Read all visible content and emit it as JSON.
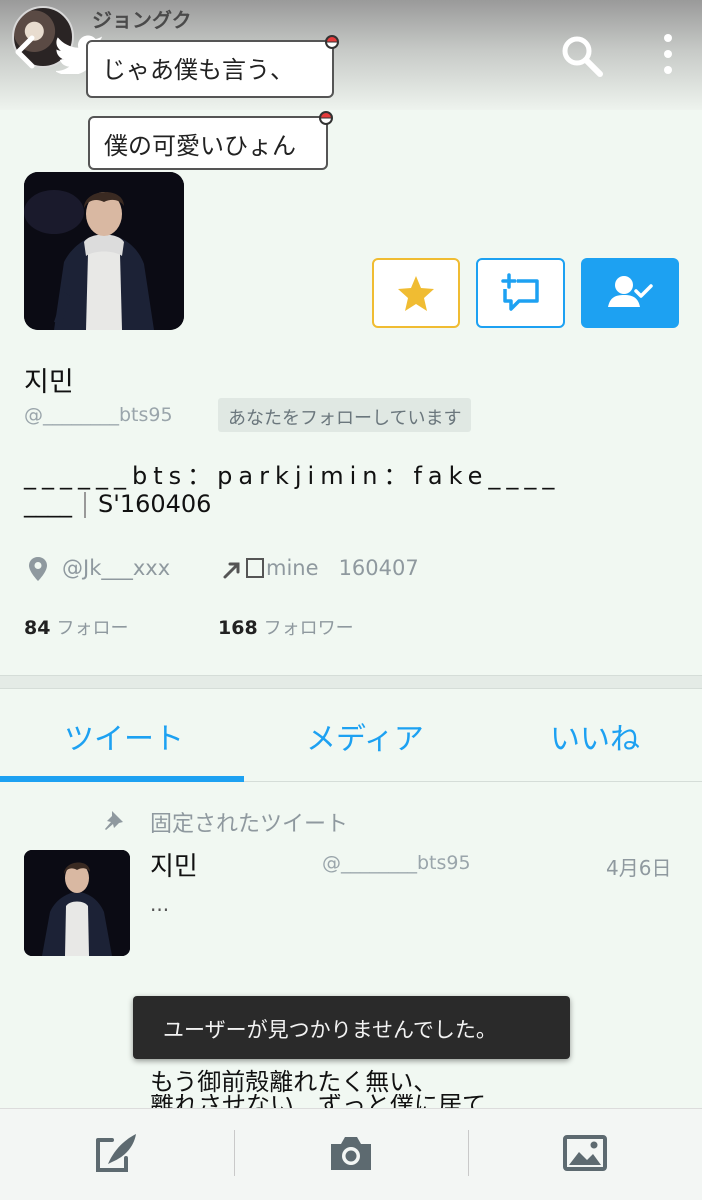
{
  "header": {
    "account_name": "ジョングク",
    "bubble1": "じゃあ僕も言う、",
    "bubble2": "僕の可愛いひょん"
  },
  "profile": {
    "display_name": "지민",
    "handle": "@________bts95",
    "follows_you": "あなたをフォローしています",
    "bio_line1": "______bts：parkjimin：fake____",
    "bio_line2_prefix": "____",
    "bio_line2_suffix": "S'160406",
    "location": "@Jk___xxx",
    "link": "mine",
    "joined": "160407",
    "following_count": "84",
    "following_label": "フォロー",
    "followers_count": "168",
    "followers_label": "フォロワー"
  },
  "tabs": [
    {
      "label": "ツイート",
      "selected": true
    },
    {
      "label": "メディア",
      "selected": false
    },
    {
      "label": "いいね",
      "selected": false
    }
  ],
  "pinned_tweet": {
    "label": "固定されたツイート",
    "name": "지민",
    "handle": "@________bts95",
    "date": "4月6日",
    "body": "...",
    "line1": "もう御前殻離れたく無い、",
    "line2": "離れさせない、ずっと僕に居て"
  },
  "toast": {
    "message": "ユーザーが見つかりませんでした。"
  },
  "icons": {
    "back": "back-icon",
    "bird": "twitter-bird-icon",
    "search": "search-icon",
    "more": "more-icon",
    "star": "star-icon",
    "reply": "reply-icon",
    "follow": "following-icon",
    "location": "location-icon",
    "link": "link-icon",
    "pin": "pin-icon",
    "compose": "compose-icon",
    "camera": "camera-icon",
    "image": "image-icon"
  },
  "colors": {
    "accent": "#1da1f2",
    "star": "#f0bc32",
    "background": "#f1f8f2",
    "toast": "#2a2a2a"
  }
}
